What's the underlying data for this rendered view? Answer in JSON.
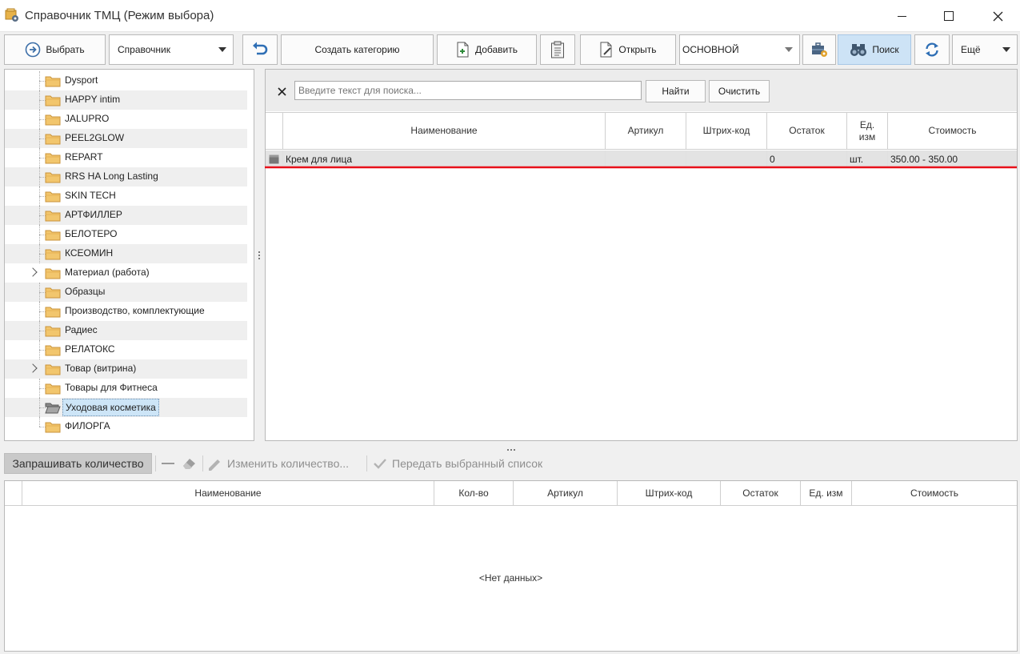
{
  "window": {
    "title": "Справочник ТМЦ (Режим выбора)"
  },
  "toolbar": {
    "select_label": "Выбрать",
    "catalog_label": "Справочник",
    "create_category_label": "Создать категорию",
    "add_label": "Добавить",
    "open_label": "Открыть",
    "warehouse_value": "ОСНОВНОЙ",
    "search_label": "Поиск",
    "more_label": "Ещё"
  },
  "tree": {
    "items": [
      {
        "label": "Dysport"
      },
      {
        "label": "HAPPY intim"
      },
      {
        "label": "JALUPRO"
      },
      {
        "label": "PEEL2GLOW"
      },
      {
        "label": "REPART"
      },
      {
        "label": "RRS HA Long Lasting"
      },
      {
        "label": "SKIN TECH"
      },
      {
        "label": "АРТФИЛЛЕР"
      },
      {
        "label": "БЕЛОТЕРО"
      },
      {
        "label": "КСЕОМИН"
      },
      {
        "label": "Материал (работа)"
      },
      {
        "label": "Образцы"
      },
      {
        "label": "Производство, комплектующие"
      },
      {
        "label": "Радиес"
      },
      {
        "label": "РЕЛАТОКС"
      },
      {
        "label": "Товар (витрина)"
      },
      {
        "label": "Товары для Фитнеса"
      },
      {
        "label": "Уходовая косметика"
      },
      {
        "label": "ФИЛОРГА"
      }
    ]
  },
  "search": {
    "placeholder": "Введите текст для поиска...",
    "find_label": "Найти",
    "clear_label": "Очистить"
  },
  "main_grid": {
    "headers": {
      "name": "Наименование",
      "article": "Артикул",
      "barcode": "Штрих-код",
      "stock": "Остаток",
      "unit": "Ед. изм",
      "cost": "Стоимость"
    },
    "rows": [
      {
        "name": "Крем для лица",
        "article": "",
        "barcode": "",
        "stock": "0",
        "unit": "шт.",
        "cost": "350.00 - 350.00"
      }
    ]
  },
  "bottom_toolbar": {
    "ask_quantity": "Запрашивать количество",
    "change_quantity": "Изменить количество...",
    "transfer_list": "Передать выбранный список"
  },
  "bottom_grid": {
    "headers": {
      "name": "Наименование",
      "qty": "Кол-во",
      "article": "Артикул",
      "barcode": "Штрих-код",
      "stock": "Остаток",
      "unit": "Ед. изм",
      "cost": "Стоимость"
    },
    "empty_text": "<Нет данных>"
  },
  "colors": {
    "selection": "#cde5f7",
    "active_button": "#cde3f6",
    "highlight_line": "#e8101a"
  }
}
